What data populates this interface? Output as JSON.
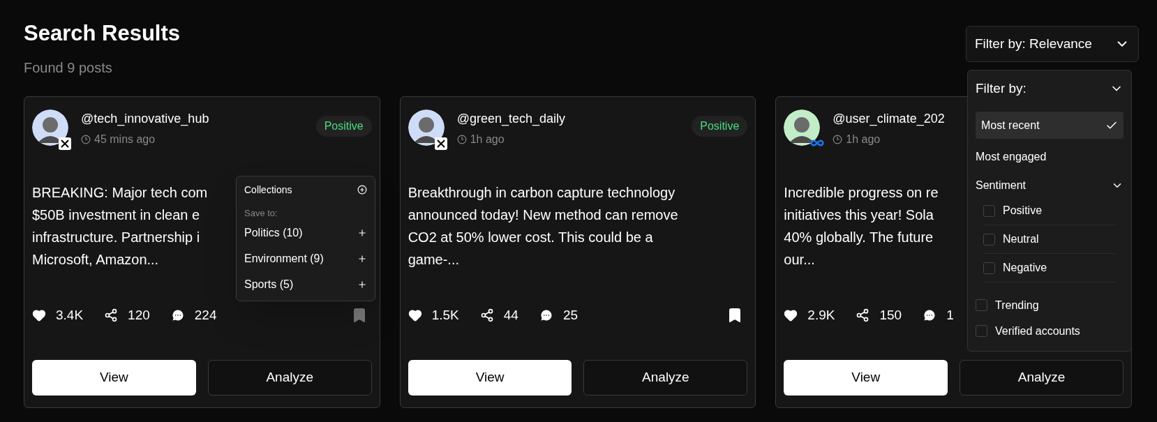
{
  "header": {
    "title": "Search Results",
    "subtitle": "Found 9 posts"
  },
  "filter_button": {
    "label": "Filter by: Relevance"
  },
  "filter_menu": {
    "title": "Filter by:",
    "items": [
      {
        "kind": "option",
        "label": "Most recent",
        "selected": true
      },
      {
        "kind": "option",
        "label": "Most engaged",
        "selected": false
      },
      {
        "kind": "group",
        "label": "Sentiment",
        "expanded": true,
        "children": [
          {
            "label": "Positive",
            "checked": false
          },
          {
            "label": "Neutral",
            "checked": false
          },
          {
            "label": "Negative",
            "checked": false
          }
        ]
      },
      {
        "kind": "check",
        "label": "Trending",
        "checked": false
      },
      {
        "kind": "check",
        "label": "Verified accounts",
        "checked": false
      }
    ]
  },
  "posts": [
    {
      "username": "@tech_innovative_hub",
      "time": "45 mins ago",
      "kind": "x",
      "color": "#cfdcf7",
      "sentiment": "Positive",
      "body_lines": [
        "BREAKING: Major tech com",
        "$50B investment in clean e",
        "infrastructure. Partnership i",
        "Microsoft, Amazon..."
      ],
      "likes": "3.4K",
      "shares": "120",
      "comments": "224",
      "saved": false,
      "collections": {
        "title": "Collections",
        "hint": "Save to:",
        "items": [
          "Politics (10)",
          "Environment (9)",
          "Sports (5)"
        ]
      },
      "buttons": [
        "View",
        "Analyze"
      ]
    },
    {
      "username": "@green_tech_daily",
      "time": "1h ago",
      "kind": "x",
      "color": "#cfdcf7",
      "sentiment": "Positive",
      "body_lines": [
        "Breakthrough in carbon capture technology",
        "announced today! New method can remove",
        "CO2 at 50% lower cost. This could be a",
        "game-..."
      ],
      "likes": "1.5K",
      "shares": "44",
      "comments": "25",
      "saved": true,
      "buttons": [
        "View",
        "Analyze"
      ]
    },
    {
      "username": "@user_climate_202",
      "time": "1h ago",
      "kind": "meta",
      "color": "#c3ecc8",
      "body_lines": [
        "Incredible progress on re",
        "initiatives this year! Sola",
        "40% globally. The future",
        "our..."
      ],
      "likes": "2.9K",
      "shares": "150",
      "comments": "1",
      "buttons": [
        "View",
        "Analyze"
      ]
    }
  ]
}
